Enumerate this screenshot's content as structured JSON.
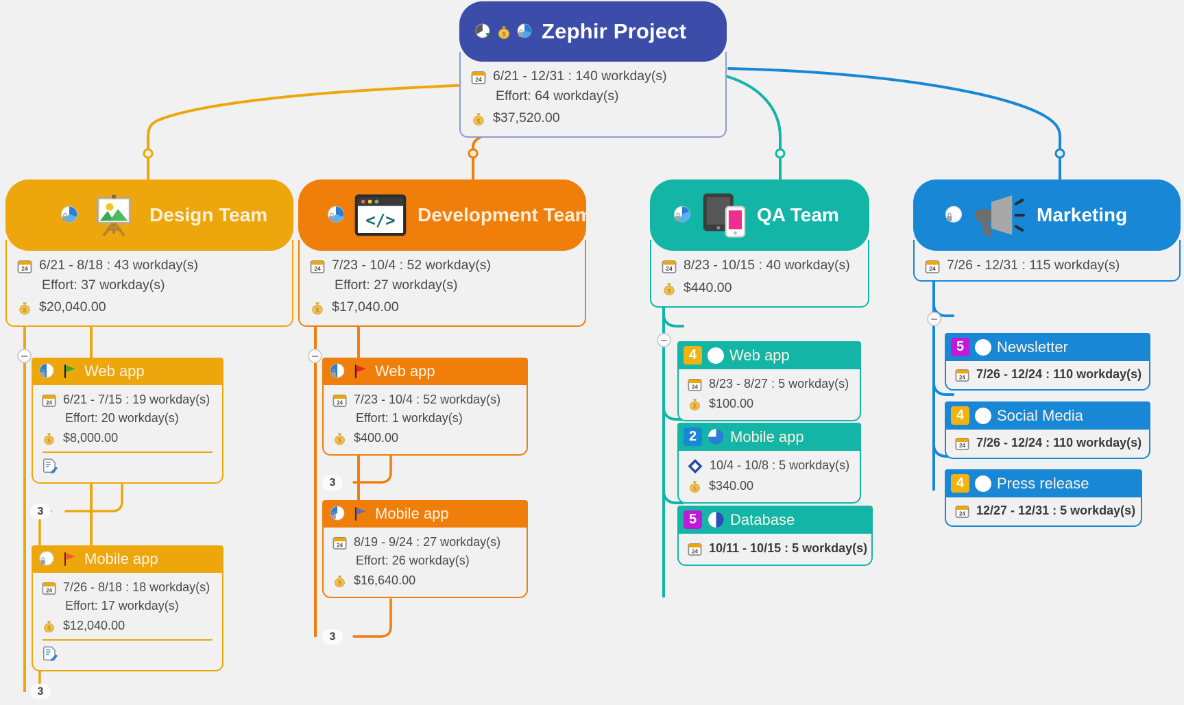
{
  "meta": {
    "background": "#f1f1f1",
    "title": "Zephir Project mind map"
  },
  "root": {
    "title": "Zephir Project",
    "color": "#3b4da8",
    "body_border": "#8f9bd4",
    "icons": [
      "clock-pie-icon",
      "money-bag-icon",
      "pie-lock-icon"
    ],
    "date_line": "6/21 - 12/31 : 140 workday(s)",
    "effort_line": "Effort: 64 workday(s)",
    "cost_line": "$37,520.00"
  },
  "teams": [
    {
      "id": "design",
      "title": "Design Team",
      "color": "#eda70d",
      "header_icon": "easel-picture-icon",
      "progress_icon": "pie-lock-icon",
      "date_line": "6/21 - 8/18 : 43 workday(s)",
      "effort_line": "Effort: 37 workday(s)",
      "cost_line": "$20,040.00",
      "tasks": [
        {
          "name": "Web app",
          "header_color": "#eda70d",
          "border_color": "#eda70d",
          "flag": "green-flag-icon",
          "flag_color": "#2ab32a",
          "progress_icon": "pie-half-icon",
          "date_line": "6/21 - 7/15 : 19 workday(s)",
          "effort_line": "Effort: 20 workday(s)",
          "cost_line": "$8,000.00",
          "note_icon": "note-edit-icon",
          "has_note": true
        },
        {
          "name": "Mobile app",
          "header_color": "#eda70d",
          "border_color": "#eda70d",
          "flag": "red-flag-icon",
          "flag_color": "#f0592b",
          "progress_icon": "pie-empty-icon",
          "date_line": "7/26 - 8/18 : 18 workday(s)",
          "effort_line": "Effort: 17 workday(s)",
          "cost_line": "$12,040.00",
          "note_icon": "note-edit-icon",
          "has_note": true
        }
      ],
      "lag_labels": [
        "3",
        "3"
      ]
    },
    {
      "id": "development",
      "title": "Development Team",
      "color": "#f07e0a",
      "header_icon": "code-window-icon",
      "progress_icon": "pie-lock-icon",
      "date_line": "7/23 - 10/4 : 52 workday(s)",
      "effort_line": "Effort: 27 workday(s)",
      "cost_line": "$17,040.00",
      "tasks": [
        {
          "name": "Web app",
          "header_color": "#f07e0a",
          "border_color": "#f07e0a",
          "flag": "red-flag-icon",
          "flag_color": "#e8252a",
          "progress_icon": "pie-half-icon",
          "date_line": "7/23 - 10/4 : 52 workday(s)",
          "effort_line": "Effort: 1 workday(s)",
          "cost_line": "$400.00",
          "has_note": false
        },
        {
          "name": "Mobile app",
          "header_color": "#f07e0a",
          "border_color": "#f07e0a",
          "flag": "purple-flag-icon",
          "flag_color": "#6b66c9",
          "progress_icon": "pie-quarter-icon",
          "date_line": "8/19 - 9/24 : 27 workday(s)",
          "effort_line": "Effort: 26 workday(s)",
          "cost_line": "$16,640.00",
          "has_note": false
        }
      ],
      "lag_labels": [
        "3",
        "3"
      ]
    },
    {
      "id": "qa",
      "title": "QA Team",
      "color": "#13b5a6",
      "header_icon": "tablet-phone-icon",
      "progress_icon": "pie-lock-icon",
      "date_line": "8/23 - 10/15 : 40 workday(s)",
      "effort_line": "",
      "cost_line": "$440.00",
      "tasks": [
        {
          "name": "Web app",
          "header_color": "#13b5a6",
          "border_color": "#13b5a6",
          "priority": "4",
          "priority_color": "#f0b310",
          "progress": 0,
          "date_icon": "calendar-icon",
          "date_line": "8/23 - 8/27 : 5 workday(s)",
          "cost_line": "$100.00"
        },
        {
          "name": "Mobile app",
          "header_color": "#13b5a6",
          "border_color": "#13b5a6",
          "priority": "2",
          "priority_color": "#1787d6",
          "progress": 75,
          "date_icon": "milestone-diamond-icon",
          "date_line": "10/4 - 10/8 : 5 workday(s)",
          "cost_line": "$340.00"
        },
        {
          "name": "Database",
          "header_color": "#13b5a6",
          "border_color": "#13b5a6",
          "priority": "5",
          "priority_color": "#c01ad8",
          "progress": 50,
          "date_icon": "calendar-icon",
          "date_line": "10/11 - 10/15 : 5 workday(s)",
          "cost_line": ""
        }
      ]
    },
    {
      "id": "marketing",
      "title": "Marketing",
      "color": "#1787d6",
      "header_icon": "megaphone-icon",
      "progress_icon": "pie-empty-lock-icon",
      "date_line": "7/26 - 12/31 : 115 workday(s)",
      "effort_line": "",
      "cost_line": "",
      "tasks": [
        {
          "name": "Newsletter",
          "header_color": "#1787d6",
          "border_color": "#1787d6",
          "priority": "5",
          "priority_color": "#c01ad8",
          "progress": 0,
          "date_icon": "calendar-icon",
          "date_line": "7/26 - 12/24 : 110 workday(s)",
          "cost_line": ""
        },
        {
          "name": "Social Media",
          "header_color": "#1787d6",
          "border_color": "#1787d6",
          "priority": "4",
          "priority_color": "#f0b310",
          "progress": 0,
          "date_icon": "calendar-icon",
          "date_line": "7/26 - 12/24 : 110 workday(s)",
          "cost_line": ""
        },
        {
          "name": "Press release",
          "header_color": "#1787d6",
          "border_color": "#1787d6",
          "priority": "4",
          "priority_color": "#f0b310",
          "progress": 0,
          "date_icon": "calendar-icon",
          "date_line": "12/27 - 12/31 : 5 workday(s)",
          "cost_line": ""
        }
      ]
    }
  ]
}
